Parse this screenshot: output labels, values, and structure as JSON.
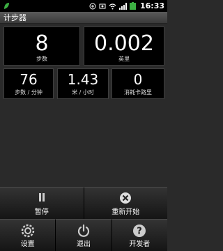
{
  "status_bar": {
    "time": "16:33",
    "icons": [
      "usb-icon",
      "photo-icon",
      "wifi-icon",
      "signal-icon",
      "battery-icon"
    ]
  },
  "app": {
    "title": "计步器"
  },
  "stats": {
    "steps": {
      "value": "8",
      "label": "步数"
    },
    "distance": {
      "value": "0.002",
      "label": "英里"
    },
    "pace": {
      "value": "76",
      "label": "步数 / 分钟"
    },
    "speed": {
      "value": "1.43",
      "label": "米 / 小时"
    },
    "calories": {
      "value": "0",
      "label": "消耗卡路里"
    }
  },
  "menu": {
    "pause": {
      "label": "暂停",
      "icon": "pause-icon"
    },
    "reset": {
      "label": "重新开始",
      "icon": "reset-icon"
    },
    "settings": {
      "label": "设置",
      "icon": "settings-icon"
    },
    "quit": {
      "label": "退出",
      "icon": "power-icon"
    },
    "developer": {
      "label": "开发者",
      "icon": "question-icon"
    }
  },
  "colors": {
    "background": "#2a2a2a",
    "card": "#000000",
    "accent_green": "#1f7a1f"
  }
}
